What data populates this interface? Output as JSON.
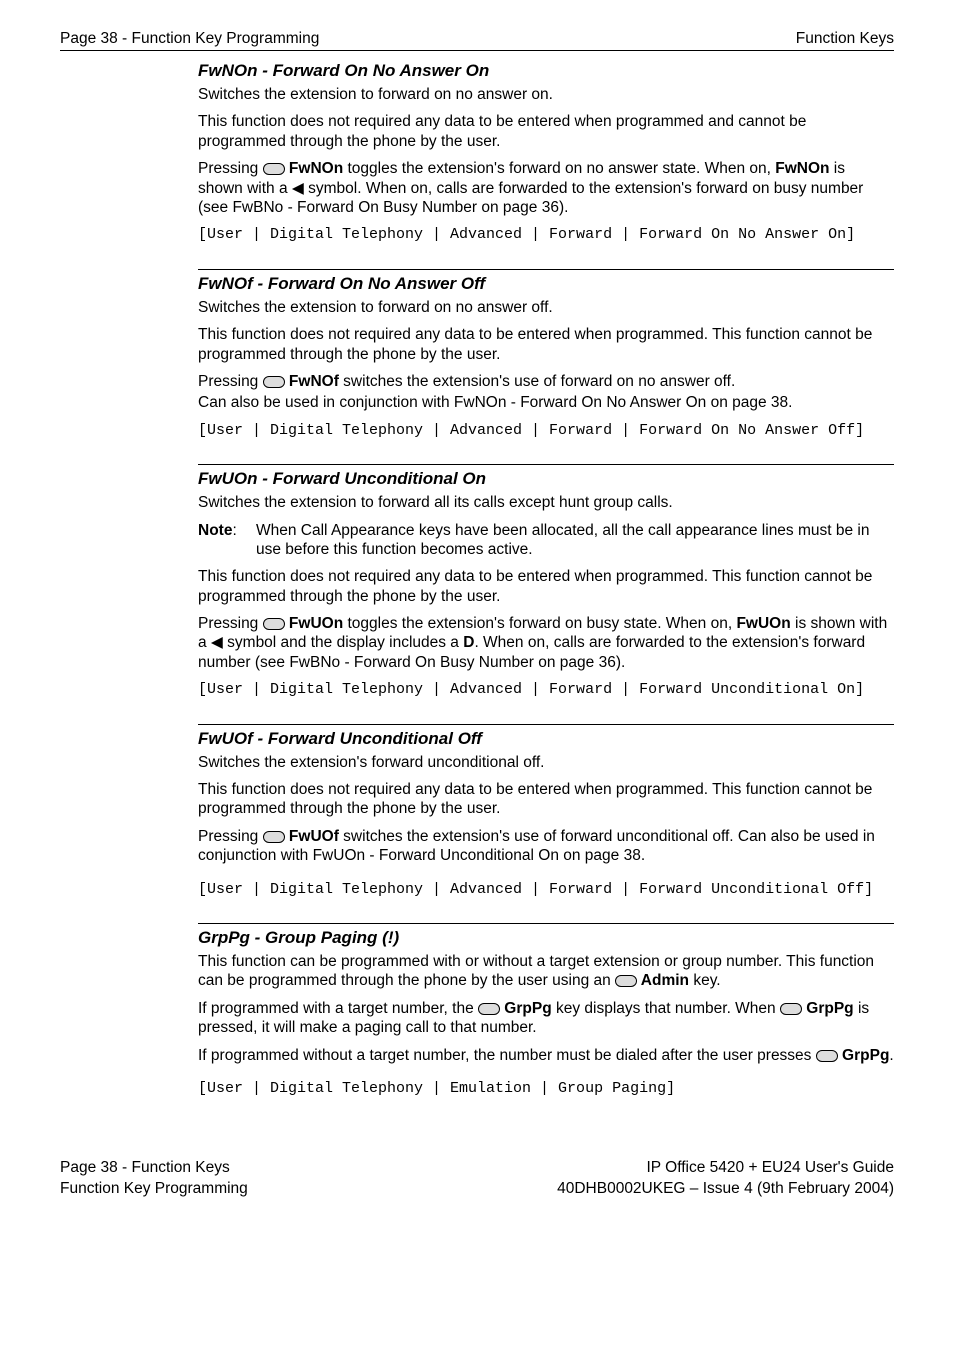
{
  "header": {
    "left": "Page 38 - Function Key Programming",
    "right": "Function Keys"
  },
  "sections": {
    "fwnon": {
      "title": "FwNOn - Forward On No Answer On",
      "p1": "Switches the extension to forward on no answer on.",
      "p2": "This function does not required any data to be entered when programmed and cannot be programmed through the phone by the user.",
      "p3a": "Pressing ",
      "p3b": " FwNOn",
      "p3c": " toggles the extension's forward on no answer state. When on, ",
      "p3d": "FwNOn",
      "p3e": " is shown with a ◀ symbol. When on, calls are forwarded to the extension's forward on busy number (see FwBNo - Forward On Busy Number on page 36).",
      "code": "[User | Digital Telephony | Advanced | Forward | Forward On No Answer On]"
    },
    "fwnof": {
      "title": "FwNOf - Forward On No Answer Off",
      "p1": "Switches the extension to forward on no answer off.",
      "p2": "This function does not required any data to be entered when programmed. This function cannot be programmed through the phone by the user.",
      "p3a": "Pressing ",
      "p3b": " FwNOf",
      "p3c": " switches the extension's use of forward on no answer off.",
      "p4": "Can also be used in conjunction with FwNOn - Forward On No Answer On on page 38.",
      "code": "[User | Digital Telephony | Advanced | Forward | Forward On No Answer Off]"
    },
    "fwuon": {
      "title": "FwUOn - Forward Unconditional On",
      "p1": "Switches the extension to forward all its calls except hunt group calls.",
      "note_label": "Note",
      "note_text": "When Call Appearance keys have been allocated, all the call appearance lines must be in use before this function becomes active.",
      "p2": "This function does not required any data to be entered when programmed. This function cannot be programmed through the phone by the user.",
      "p3a": "Pressing ",
      "p3b": " FwUOn",
      "p3c": " toggles the extension's forward on busy state. When on, ",
      "p3d": "FwUOn",
      "p3e": " is shown with a ◀ symbol and the display includes a ",
      "p3f": "D",
      "p3g": ". When on, calls are forwarded to the extension's forward number (see FwBNo - Forward On Busy Number on page 36).",
      "code": "[User | Digital Telephony | Advanced | Forward | Forward Unconditional On]"
    },
    "fwuof": {
      "title": "FwUOf - Forward Unconditional Off",
      "p1": "Switches the extension's forward unconditional off.",
      "p2": "This function does not required any data to be entered when programmed. This function cannot be programmed through the phone by the user.",
      "p3a": "Pressing ",
      "p3b": " FwUOf",
      "p3c": " switches the extension's use of forward unconditional off. Can also be used in conjunction with FwUOn - Forward Unconditional On on page 38.",
      "code": "[User | Digital Telephony | Advanced | Forward | Forward Unconditional Off]"
    },
    "grppg": {
      "title": "GrpPg - Group Paging (!)",
      "p1a": "This function can be programmed with or without a target extension or group number. This function can be programmed through the phone by the user using an ",
      "p1b": " Admin",
      "p1c": " key.",
      "p2a": "If programmed with a target number, the ",
      "p2b": " GrpPg",
      "p2c": " key displays that number. When ",
      "p2d": " GrpPg",
      "p2e": " is pressed, it will make a paging call to that number.",
      "p3a": "If programmed without a target number, the number must be dialed after the user presses ",
      "p3b": " GrpPg",
      "p3c": ".",
      "code": "[User | Digital Telephony | Emulation | Group Paging]"
    }
  },
  "footer": {
    "left1": "Page 38 - Function Keys",
    "left2": "Function Key Programming",
    "right1": "IP Office 5420 + EU24 User's Guide",
    "right2": "40DHB0002UKEG – Issue 4 (9th February 2004)"
  }
}
